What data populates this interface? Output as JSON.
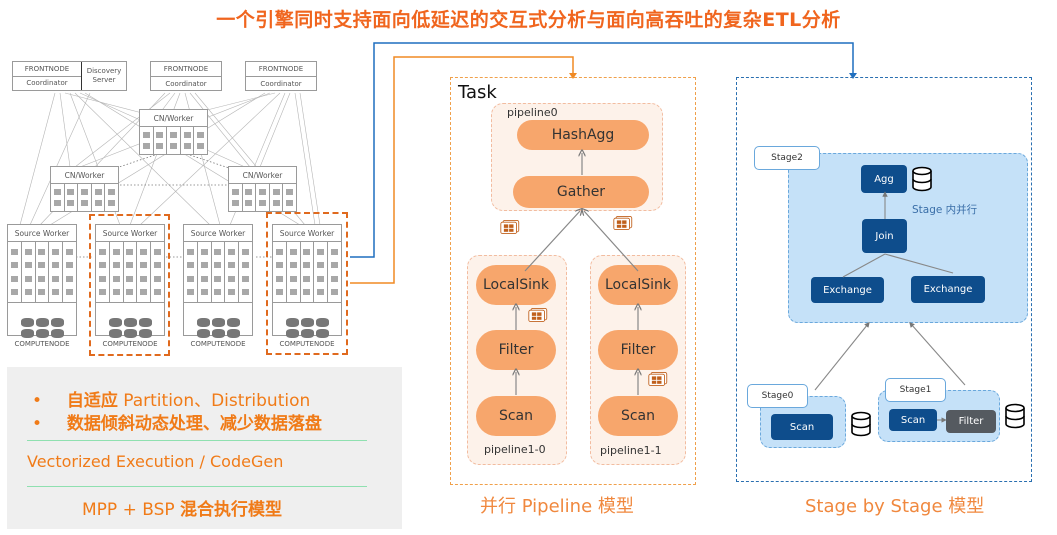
{
  "title": "一个引擎同时支持面向低延迟的交互式分析与面向高吞吐的复杂ETL分析",
  "architecture": {
    "frontnodes": [
      {
        "top": "FRONTNODE",
        "bottom": "Coordinator",
        "extra": "Discovery Server"
      },
      {
        "top": "FRONTNODE",
        "bottom": "Coordinator"
      },
      {
        "top": "FRONTNODE",
        "bottom": "Coordinator"
      }
    ],
    "cn_worker_label": "CN/Worker",
    "source_worker_label": "Source Worker",
    "computenode_label": "COMPUTENODE"
  },
  "features": {
    "bullet": "•",
    "item1_bold": "自适应",
    "item1_rest": " Partition、Distribution",
    "item2": "数据倾斜动态处理、减少数据落盘",
    "vectorized": "Vectorized Execution  / CodeGen",
    "mpp_prefix": "MPP + BSP ",
    "mpp_bold": "混合执行模型"
  },
  "pipeline_model": {
    "task_label": "Task",
    "pipeline0": {
      "label": "pipeline0",
      "ops": [
        "HashAgg",
        "Gather"
      ]
    },
    "pipeline1_0": {
      "label": "pipeline1-0",
      "ops": [
        "LocalSink",
        "Filter",
        "Scan"
      ]
    },
    "pipeline1_1": {
      "label": "pipeline1-1",
      "ops": [
        "LocalSink",
        "Filter",
        "Scan"
      ]
    },
    "caption": "并行 Pipeline 模型"
  },
  "stage_model": {
    "stage2": {
      "label": "Stage2",
      "ops": [
        "Agg",
        "Join",
        "Exchange",
        "Exchange"
      ],
      "note": "Stage 内并行"
    },
    "stage0": {
      "label": "Stage0",
      "ops": [
        "Scan"
      ]
    },
    "stage1": {
      "label": "Stage1",
      "ops": [
        "Scan",
        "Filter"
      ]
    },
    "caption": "Stage by Stage 模型"
  },
  "colors": {
    "title": "#f0651e",
    "pipeline_op": "#f7a66c",
    "stage_op": "#0e4d8c",
    "connector_blue": "#1f6fbf",
    "connector_orange": "#f08a24"
  }
}
